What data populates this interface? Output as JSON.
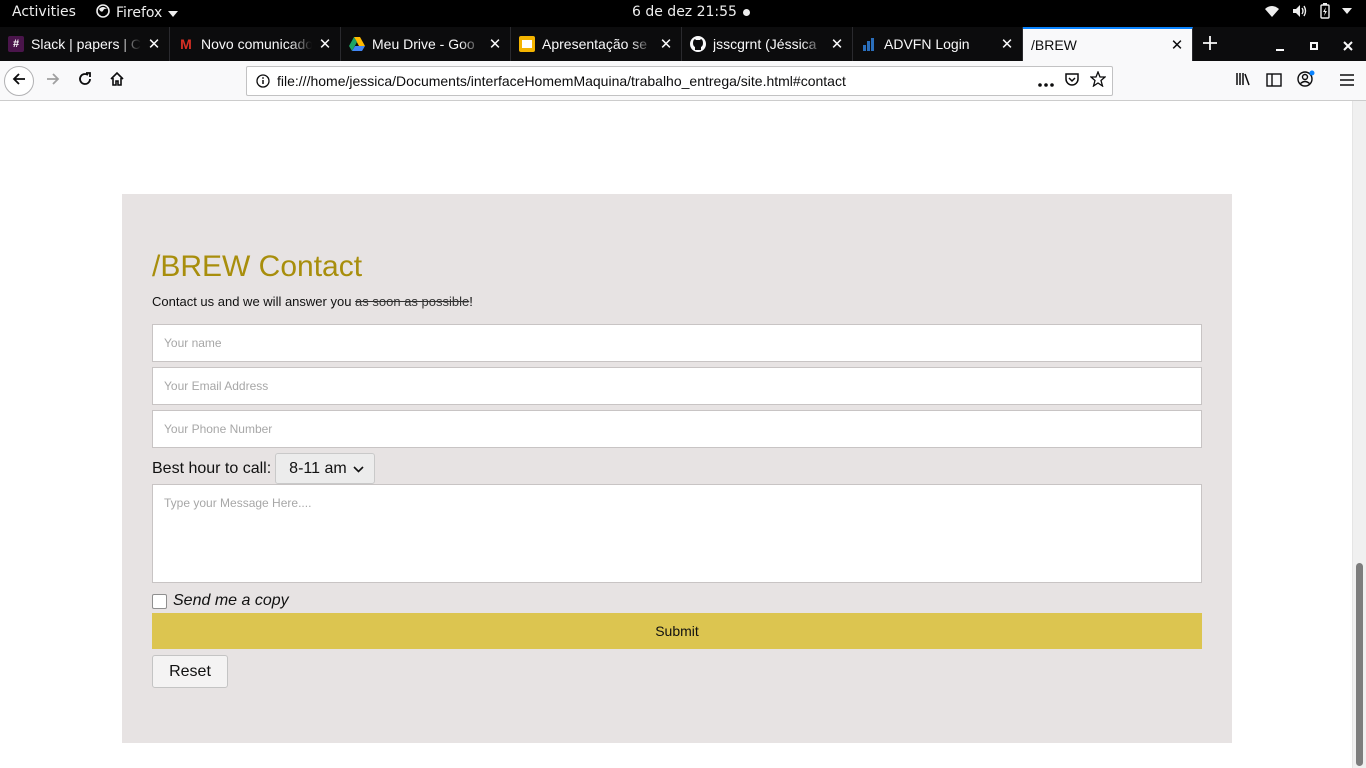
{
  "topbar": {
    "activities": "Activities",
    "app_name": "Firefox",
    "clock": "6 de dez  21:55"
  },
  "tabs": [
    {
      "title": "Slack | papers | C",
      "favicon": "slack-icon",
      "color": "#4a154b"
    },
    {
      "title": "Novo comunicado",
      "favicon": "gmail-icon",
      "color": "#d93025"
    },
    {
      "title": "Meu Drive - Goo",
      "favicon": "google-drive-icon",
      "color": "#1fa463"
    },
    {
      "title": "Apresentação se",
      "favicon": "google-slides-icon",
      "color": "#f4b400"
    },
    {
      "title": "jsscgrnt (Jéssica",
      "favicon": "github-icon",
      "color": "#f9f9fa"
    },
    {
      "title": "ADVFN Login",
      "favicon": "advfn-icon",
      "color": "#2a6ebb"
    },
    {
      "title": "/BREW",
      "favicon": "",
      "color": ""
    }
  ],
  "navbar": {
    "url": "file:///home/jessica/Documents/interfaceHomemMaquina/trabalho_entrega/site.html#contact"
  },
  "contact": {
    "heading": "/BREW Contact",
    "intro_start": "Contact us and we will answer you ",
    "intro_struck": "as soon as possible",
    "intro_end": "!",
    "name_placeholder": "Your name",
    "email_placeholder": "Your Email Address",
    "phone_placeholder": "Your Phone Number",
    "hour_label": "Best hour to call:",
    "hour_selected": "8-11 am",
    "message_placeholder": "Type your Message Here....",
    "copy_label": "Send me a copy",
    "copy_checked": false,
    "submit_label": "Submit",
    "reset_label": "Reset",
    "heading_color": "#a88e0c",
    "submit_color": "#dcc550",
    "background_color": "#e7e3e3"
  }
}
